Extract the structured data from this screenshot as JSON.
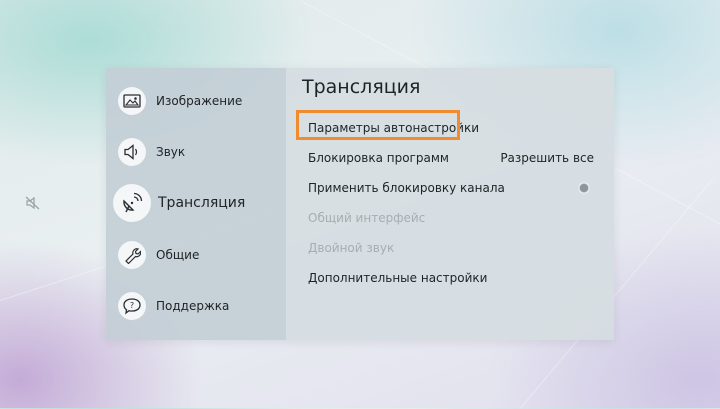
{
  "sidebar": {
    "items": [
      {
        "label": "Изображение",
        "icon": "picture-icon"
      },
      {
        "label": "Звук",
        "icon": "speaker-icon"
      },
      {
        "label": "Трансляция",
        "icon": "broadcast-icon",
        "active": true
      },
      {
        "label": "Общие",
        "icon": "wrench-icon"
      },
      {
        "label": "Поддержка",
        "icon": "support-chat-icon"
      }
    ]
  },
  "content": {
    "title": "Трансляция",
    "rows": [
      {
        "label": "Параметры автонастройки",
        "focused": true
      },
      {
        "label": "Блокировка программ",
        "value": "Разрешить все"
      },
      {
        "label": "Применить блокировку канала",
        "toggle": "off"
      },
      {
        "label": "Общий интерфейс",
        "disabled": true
      },
      {
        "label": "Двойной звук",
        "disabled": true
      },
      {
        "label": "Дополнительные настройки"
      }
    ]
  },
  "colors": {
    "focus_border": "#f08b2e",
    "sidebar_bg": "#c3ced6",
    "content_bg": "#d6dde2",
    "disabled_text": "#a7adb2"
  }
}
